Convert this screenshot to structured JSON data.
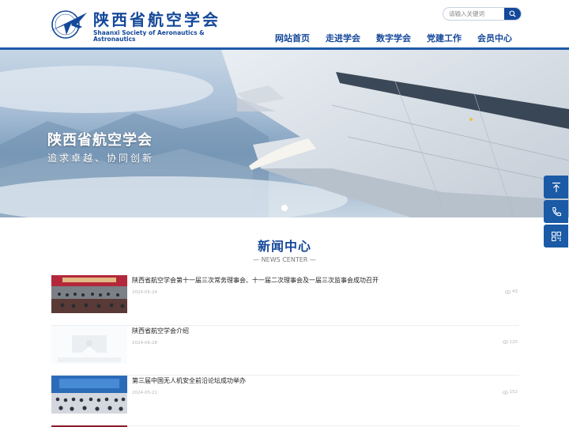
{
  "header": {
    "logo_cn": "陕西省航空学会",
    "logo_en": "Shaanxi Society of Aeronautics & Astronautics",
    "search": {
      "placeholder": "请输入关键词"
    },
    "nav": [
      "网站首页",
      "走进学会",
      "数字学会",
      "党建工作",
      "会员中心"
    ]
  },
  "banner": {
    "title": "陕西省航空学会",
    "subtitle": "追求卓越、协同创新"
  },
  "news": {
    "title": "新闻中心",
    "subtitle": "— NEWS CENTER —",
    "items": [
      {
        "title": "陕西省航空学会第十一届三次常务理事会、十一届二次理事会及一届三次监事会成功召开",
        "date": "2024-05-24",
        "views": "43"
      },
      {
        "title": "陕西省航空学会介绍",
        "date": "2024-06-28",
        "views": "120"
      },
      {
        "title": "第三届中国无人机安全前沿论坛成功举办",
        "date": "2024-05-21",
        "views": "152"
      }
    ]
  },
  "colors": {
    "brand": "#14489a",
    "accent": "#1a5aa6"
  },
  "icons": [
    "logo-plane-icon",
    "search-icon",
    "back-to-top-icon",
    "phone-icon",
    "qrcode-icon",
    "eye-icon"
  ]
}
